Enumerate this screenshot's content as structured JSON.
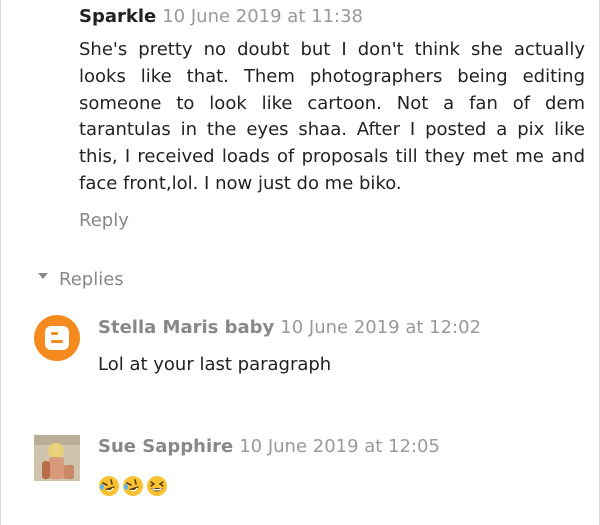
{
  "comment": {
    "author": "Sparkle",
    "date": "10 June 2019 at 11:38",
    "text": "She's pretty no doubt but I don't think she actually looks like that. Them photographers being editing someone to look like cartoon. Not a fan of dem tarantulas in the eyes shaa. After I posted a pix like this, I received loads of proposals till they met me and face front,lol. I now just do me biko.",
    "reply_label": "Reply"
  },
  "replies_toggle_label": "Replies",
  "replies": [
    {
      "author": "Stella Maris baby",
      "date": "10 June 2019 at 12:02",
      "text": "Lol at your last paragraph",
      "avatar_icon": "blogger-icon"
    },
    {
      "author": "Sue Sapphire",
      "date": "10 June 2019 at 12:05",
      "emoji_icons": [
        "rofl-emoji-icon",
        "rofl-emoji-icon",
        "grinning-squinting-emoji-icon"
      ],
      "avatar_icon": "user-photo"
    }
  ],
  "colors": {
    "text": "#222222",
    "muted": "#888888",
    "date": "#999999",
    "blogger_orange": "#f58a1f",
    "emoji_yellow": "#f9c232"
  }
}
